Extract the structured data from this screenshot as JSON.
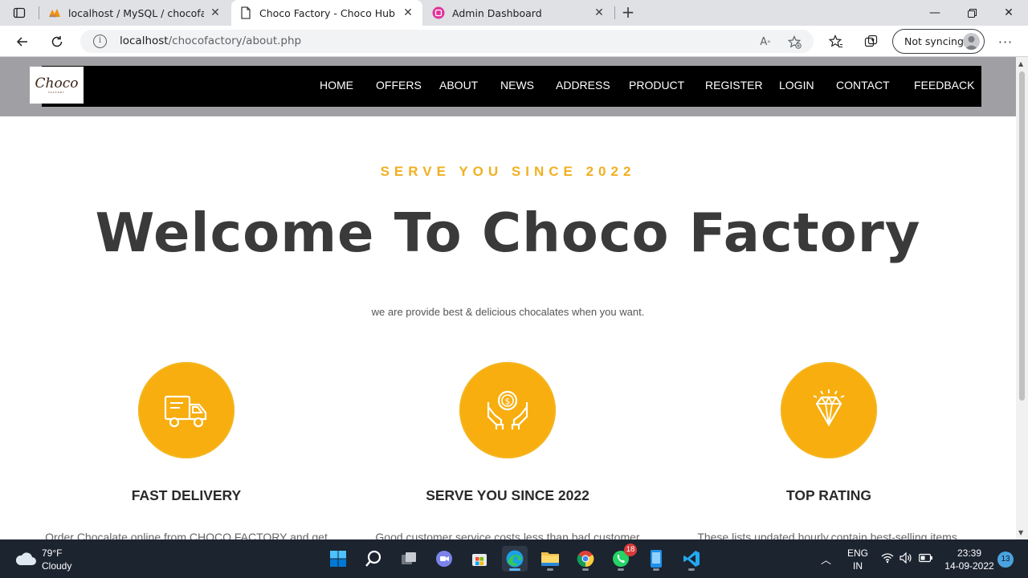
{
  "browser": {
    "tabs": [
      {
        "title": "localhost / MySQL / chocofactory",
        "favicon": "phpmyadmin-icon",
        "favicon_text": "PMA",
        "active": false
      },
      {
        "title": "Choco Factory - Choco Hub php",
        "favicon": "page-icon",
        "active": true
      },
      {
        "title": "Admin Dashboard",
        "favicon": "admin-app-icon",
        "active": false
      }
    ],
    "address": {
      "host": "localhost",
      "path": "/chocofactory/about.php"
    },
    "sync_label": "Not syncing",
    "colors": {
      "tabstrip": "#dfe1e5",
      "urlbox": "#f1f3f4"
    }
  },
  "site": {
    "logo_text": "Choco",
    "logo_subtext": "FACTORY",
    "nav": [
      "HOME",
      "OFFERS",
      "ABOUT",
      "NEWS",
      "ADDRESS",
      "PRODUCT",
      "REGISTER",
      "LOGIN",
      "CONTACT",
      "FEEDBACK"
    ],
    "eyebrow": "SERVE YOU SINCE 2022",
    "title": "Welcome To Choco Factory",
    "subtitle": "we are provide best & delicious chocalates when you want.",
    "colors": {
      "accent": "#f0b020",
      "badge": "#f7ae0e",
      "nav_bg": "#000000",
      "header_bg": "#a0a0a4"
    },
    "features": [
      {
        "icon": "delivery-truck-icon",
        "title": "FAST DELIVERY",
        "text": "Order Chocalate online from CHOCO FACTORY and get"
      },
      {
        "icon": "hands-coin-icon",
        "title": "SERVE YOU SINCE 2022",
        "text": "Good customer service costs less than bad customer"
      },
      {
        "icon": "diamond-icon",
        "title": "TOP RATING",
        "text": "These lists,updated hourly,contain best-selling items."
      }
    ]
  },
  "taskbar": {
    "weather": {
      "temp": "79°F",
      "desc": "Cloudy"
    },
    "apps": [
      {
        "name": "start-button",
        "active": false
      },
      {
        "name": "search-button",
        "active": false
      },
      {
        "name": "task-view-button",
        "active": false
      },
      {
        "name": "teams-chat-icon",
        "active": false
      },
      {
        "name": "microsoft-store-icon",
        "active": false
      },
      {
        "name": "edge-icon",
        "active": true
      },
      {
        "name": "file-explorer-icon",
        "active": false
      },
      {
        "name": "chrome-icon",
        "active": false
      },
      {
        "name": "whatsapp-icon",
        "active": false,
        "badge": "18"
      },
      {
        "name": "phone-app-icon",
        "active": false
      },
      {
        "name": "vscode-icon",
        "active": false
      }
    ],
    "language": {
      "line1": "ENG",
      "line2": "IN"
    },
    "clock": {
      "time": "23:39",
      "date": "14-09-2022"
    },
    "notifications": "13"
  }
}
